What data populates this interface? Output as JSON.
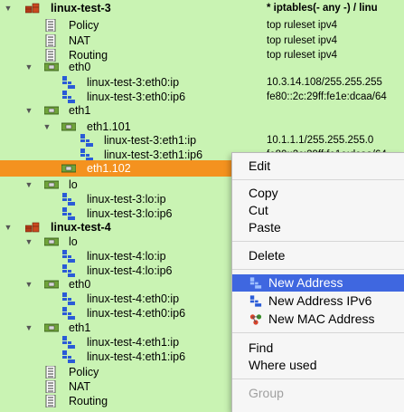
{
  "header": {
    "label": "linux-test-3",
    "value": "* iptables(- any -) / linu"
  },
  "tree": [
    {
      "label": "Policy",
      "value": "top ruleset ipv4",
      "icon": "policy-icon"
    },
    {
      "label": "NAT",
      "value": "top ruleset ipv4",
      "icon": "policy-icon"
    },
    {
      "label": "Routing",
      "value": "top ruleset ipv4",
      "icon": "policy-icon"
    },
    {
      "label": "eth0",
      "value": "",
      "icon": "interface-icon"
    },
    {
      "label": "linux-test-3:eth0:ip",
      "value": "10.3.14.108/255.255.255",
      "icon": "address-icon"
    },
    {
      "label": "linux-test-3:eth0:ip6",
      "value": "fe80::2c:29ff:fe1e:dcaa/64",
      "icon": "address-icon"
    },
    {
      "label": "eth1",
      "value": "",
      "icon": "interface-icon"
    },
    {
      "label": "eth1.101",
      "value": "",
      "icon": "interface-icon"
    },
    {
      "label": "linux-test-3:eth1:ip",
      "value": "10.1.1.1/255.255.255.0",
      "icon": "address-icon"
    },
    {
      "label": "linux-test-3:eth1:ip6",
      "value": "fe80::2c:29ff:fe1e:dcaa/64",
      "icon": "address-icon"
    },
    {
      "label": "eth1.102",
      "value": "",
      "icon": "interface-icon"
    },
    {
      "label": "lo",
      "value": "",
      "icon": "interface-icon"
    },
    {
      "label": "linux-test-3:lo:ip",
      "value": "",
      "icon": "address-icon"
    },
    {
      "label": "linux-test-3:lo:ip6",
      "value": "",
      "icon": "address-icon"
    },
    {
      "label": "linux-test-4",
      "value": "",
      "icon": "firewall-icon"
    },
    {
      "label": "lo",
      "value": "",
      "icon": "interface-icon"
    },
    {
      "label": "linux-test-4:lo:ip",
      "value": "",
      "icon": "address-icon"
    },
    {
      "label": "linux-test-4:lo:ip6",
      "value": "",
      "icon": "address-icon"
    },
    {
      "label": "eth0",
      "value": "",
      "icon": "interface-icon"
    },
    {
      "label": "linux-test-4:eth0:ip",
      "value": "",
      "icon": "address-icon"
    },
    {
      "label": "linux-test-4:eth0:ip6",
      "value": "",
      "icon": "address-icon"
    },
    {
      "label": "eth1",
      "value": "",
      "icon": "interface-icon"
    },
    {
      "label": "linux-test-4:eth1:ip",
      "value": "",
      "icon": "address-icon"
    },
    {
      "label": "linux-test-4:eth1:ip6",
      "value": "",
      "icon": "address-icon"
    },
    {
      "label": "Policy",
      "value": "",
      "icon": "policy-icon"
    },
    {
      "label": "NAT",
      "value": "",
      "icon": "policy-icon"
    },
    {
      "label": "Routing",
      "value": "",
      "icon": "policy-icon"
    }
  ],
  "menu": {
    "edit": "Edit",
    "copy": "Copy",
    "cut": "Cut",
    "paste": "Paste",
    "delete": "Delete",
    "new_address": "New Address",
    "new_address_ipv6": "New Address IPv6",
    "new_mac_address": "New MAC Address",
    "find": "Find",
    "where_used": "Where used",
    "group": "Group"
  },
  "colors": {
    "tree_background": "#c9f3b3",
    "selected_row": "#f4921f",
    "menu_highlight": "#3f67e0"
  }
}
